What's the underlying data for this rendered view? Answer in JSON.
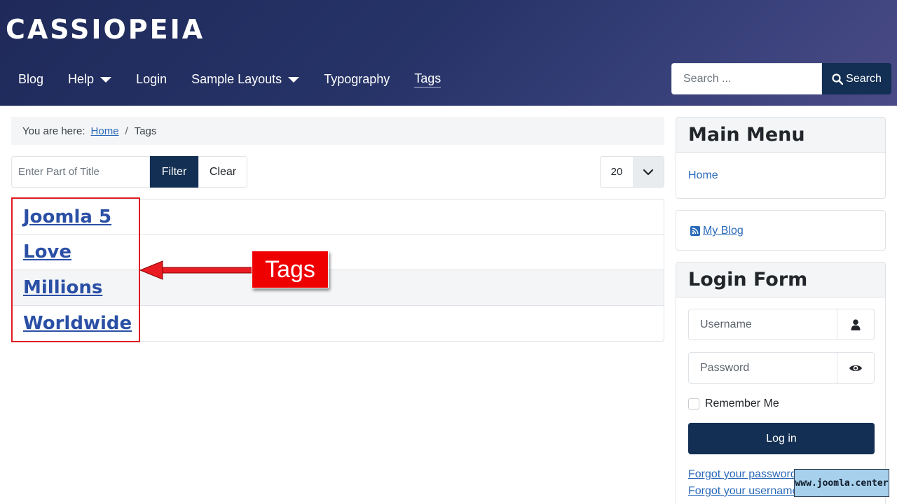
{
  "brand": "CASSIOPEIA",
  "nav": {
    "items": [
      {
        "label": "Blog"
      },
      {
        "label": "Help"
      },
      {
        "label": "Login"
      },
      {
        "label": "Sample Layouts"
      },
      {
        "label": "Typography"
      },
      {
        "label": "Tags"
      }
    ]
  },
  "search": {
    "placeholder": "Search ...",
    "button_label": "Search"
  },
  "breadcrumb": {
    "prefix": "You are here:",
    "home": "Home",
    "separator": "/",
    "current": "Tags"
  },
  "filter": {
    "placeholder": "Enter Part of Title",
    "filter_label": "Filter",
    "clear_label": "Clear",
    "limit": "20"
  },
  "tags": [
    {
      "label": "Joomla 5"
    },
    {
      "label": "Love"
    },
    {
      "label": "Millions"
    },
    {
      "label": "Worldwide"
    }
  ],
  "annotation": {
    "label": "Tags",
    "color": "#ee0000"
  },
  "sidebar": {
    "main_menu": {
      "title": "Main Menu",
      "items": [
        {
          "label": "Home"
        }
      ]
    },
    "blog": {
      "label": "My Blog"
    },
    "login_form": {
      "title": "Login Form",
      "username_placeholder": "Username",
      "password_placeholder": "Password",
      "remember_label": "Remember Me",
      "login_label": "Log in",
      "forgot_password": "Forgot your password?",
      "forgot_username": "Forgot your username?"
    }
  },
  "watermark": "www.joomla.center",
  "colors": {
    "header": "#263367",
    "primary": "#132f53",
    "link": "#2a69b8",
    "tag_link": "#2a4fa5"
  }
}
